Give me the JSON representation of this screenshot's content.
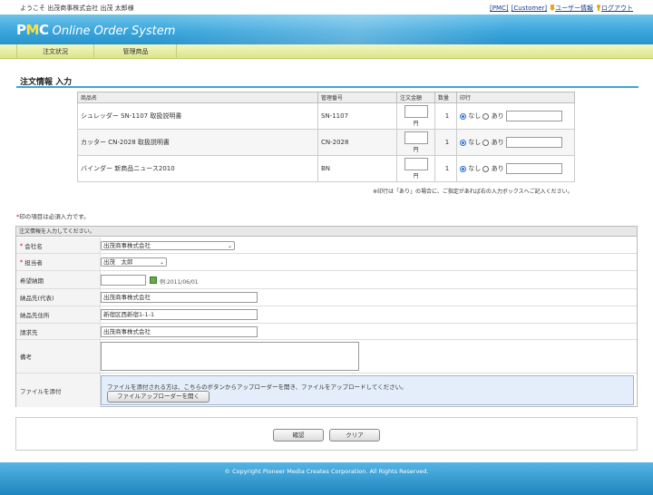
{
  "topbar": {
    "welcome": "ようこそ 出茂商事株式会社 出茂 太郎様",
    "links": {
      "pmc": "[PMC]",
      "customer": "[Customer]",
      "user_info": "ユーザー情報",
      "logout": "ログアウト"
    }
  },
  "header": {
    "logo_pmc_p": "P",
    "logo_pmc_m": "M",
    "logo_pmc_c": "C",
    "logo_system": " Online Order System"
  },
  "nav": {
    "items": [
      {
        "label": "注文状況"
      },
      {
        "label": "管理商品"
      }
    ]
  },
  "page": {
    "title": "注文情報 入力"
  },
  "items_table": {
    "headers": {
      "name": "商品名",
      "code": "管理番号",
      "price": "注文金額",
      "qty": "数量",
      "print": "印行"
    },
    "rows": [
      {
        "name": "シュレッダー SN-1107 取扱説明書",
        "code": "SN-1107",
        "yen": "円",
        "qty": "1",
        "opt_none": "なし",
        "opt_yes": "あり"
      },
      {
        "name": "カッター CN-2028 取扱説明書",
        "code": "CN-2028",
        "yen": "円",
        "qty": "1",
        "opt_none": "なし",
        "opt_yes": "あり"
      },
      {
        "name": "バインダー 新商品ニュース2010",
        "code": "BN",
        "yen": "円",
        "qty": "1",
        "opt_none": "なし",
        "opt_yes": "あり"
      }
    ],
    "note": "※印行は「あり」の場合に、ご指定があれば右の入力ボックスへご記入ください。"
  },
  "form": {
    "required_note_star": "*",
    "required_note": "印の項目は必須入力です。",
    "heading": "注文情報を入力してください。",
    "company": {
      "label": "会社名",
      "value": "出茂商事株式会社"
    },
    "person": {
      "label": "担当者",
      "value": "出茂　太郎"
    },
    "delivery_date": {
      "label": "希望納期",
      "example": "例:2011/06/01"
    },
    "ship_to_rep": {
      "label": "納品先(代表)",
      "value": "出茂商事株式会社"
    },
    "ship_to_address": {
      "label": "納品先住所",
      "value": "新宿区西新宿1-1-1"
    },
    "bill_to": {
      "label": "請求先",
      "value": "出茂商事株式会社"
    },
    "remarks": {
      "label": "備考"
    },
    "attach": {
      "label": "ファイルを添付",
      "description": "ファイルを添付される方は、こちらのボタンからアップローダーを開き、ファイルをアップロードしてください。",
      "button": "ファイルアップローダーを開く"
    }
  },
  "actions": {
    "confirm": "確認",
    "clear": "クリア"
  },
  "footer": {
    "copyright": "© Copyright Pioneer Media Creates Corporation. All Rights Reserved."
  },
  "colors": {
    "header_blue": "#3aa6dc",
    "nav_green": "#dbe58a",
    "required_red": "#dd0000"
  }
}
